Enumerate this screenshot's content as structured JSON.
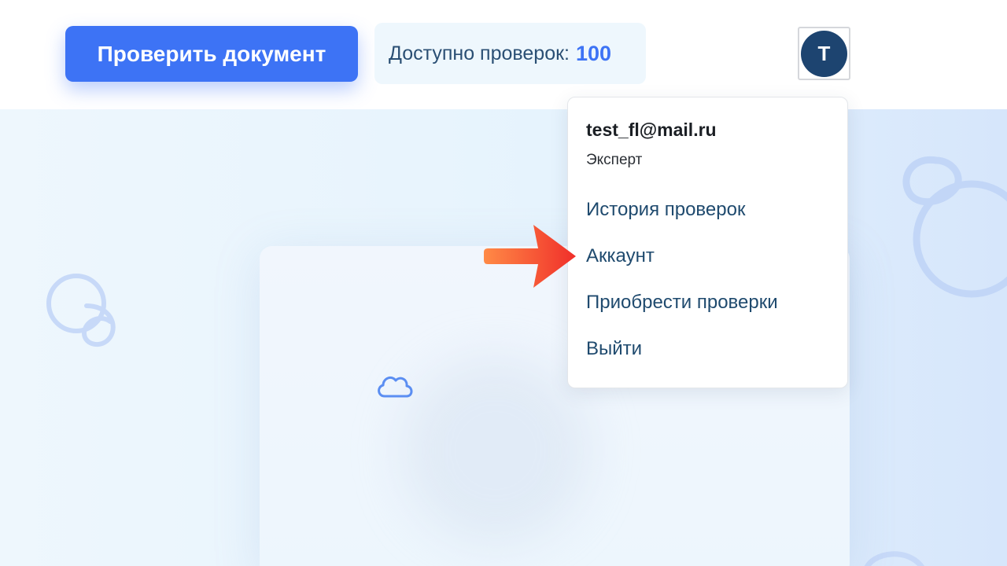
{
  "header": {
    "check_button_label": "Проверить документ",
    "credits_label": "Доступно проверок:",
    "credits_count": "100",
    "avatar_letter": "T"
  },
  "user_menu": {
    "email": "test_fl@mail.ru",
    "role": "Эксперт",
    "items": [
      {
        "label": "История проверок"
      },
      {
        "label": "Аккаунт"
      },
      {
        "label": "Приобрести проверки"
      },
      {
        "label": "Выйти"
      }
    ]
  },
  "colors": {
    "accent": "#3d73f5",
    "avatar": "#1d4470",
    "menu_text": "#1f4a6e",
    "arrow": "#f2462b"
  },
  "icons": [
    "cloud-icon",
    "arrow-pointer-icon"
  ]
}
